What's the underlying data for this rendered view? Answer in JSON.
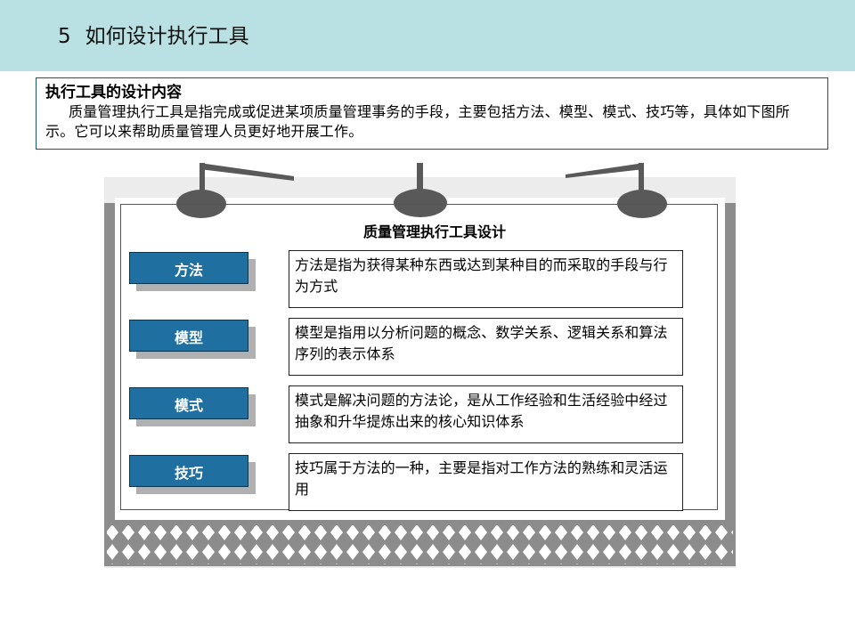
{
  "header": {
    "number": "5",
    "title": "如何设计执行工具"
  },
  "intro": {
    "heading": "执行工具的设计内容",
    "text": "质量管理执行工具是指完成或促进某项质量管理事务的手段，主要包括方法、模型、模式、技巧等，具体如下图所示。它可以来帮助质量管理人员更好地开展工作。"
  },
  "diagram": {
    "title": "质量管理执行工具设计",
    "rows": [
      {
        "label": "方法",
        "description": "方法是指为获得某种东西或达到某种目的而采取的手段与行为方式"
      },
      {
        "label": "模型",
        "description": "模型是指用以分析问题的概念、数学关系、逻辑关系和算法序列的表示体系"
      },
      {
        "label": "模式",
        "description": "模式是解决问题的方法论，是从工作经验和生活经验中经过抽象和升华提炼出来的核心知识体系"
      },
      {
        "label": "技巧",
        "description": "技巧属于方法的一种，主要是指对工作方法的熟练和灵活运用"
      }
    ]
  },
  "colors": {
    "header_bg": "#b9e0e2",
    "label_bg": "#1f6fa1",
    "box_border": "#1f4e79"
  }
}
